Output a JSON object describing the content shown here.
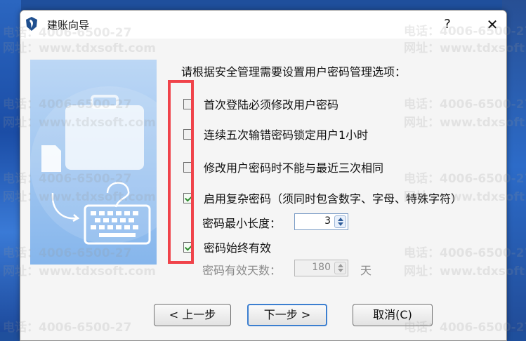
{
  "dialog": {
    "title": "建账向导",
    "help": "?",
    "close": "✕"
  },
  "watermark": {
    "phone": "电话：4006-6500-27",
    "site": "网址：www.tdxsoft.com"
  },
  "main": {
    "instruction": "请根据安全管理需要设置用户密码管理选项：",
    "options": [
      {
        "label": "首次登陆必须修改用户密码",
        "checked": false
      },
      {
        "label": "连续五次输错密码锁定用户1小时",
        "checked": false
      },
      {
        "label": "修改用户密码时不能与最近三次相同",
        "checked": false
      },
      {
        "label": "启用复杂密码（须同时包含数字、字母、特殊字符）",
        "checked": true
      },
      {
        "label": "密码始终有效",
        "checked": true
      }
    ],
    "min_length": {
      "label": "密码最小长度：",
      "value": "3"
    },
    "valid_days": {
      "label": "密码有效天数：",
      "value": "180",
      "unit": "天"
    }
  },
  "footer": {
    "prev": "< 上一步",
    "next": "下一步 >",
    "cancel": "取消(C)"
  },
  "colors": {
    "highlight": "#f0434a",
    "check": "#2e8b2e",
    "accent": "#3c7fd0"
  }
}
